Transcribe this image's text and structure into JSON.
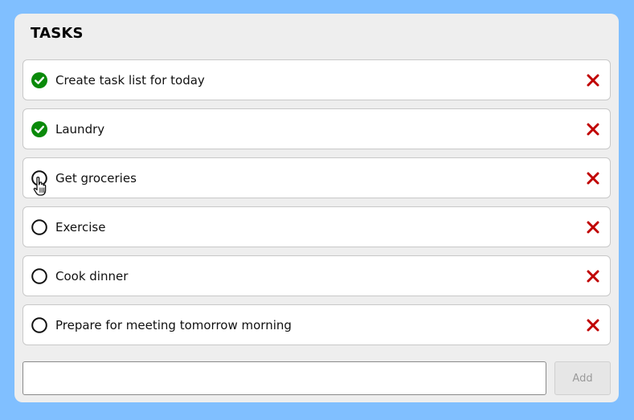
{
  "header": {
    "title": "TASKS"
  },
  "tasks": [
    {
      "label": "Create task list for today",
      "done": true
    },
    {
      "label": "Laundry",
      "done": true
    },
    {
      "label": "Get groceries",
      "done": false
    },
    {
      "label": "Exercise",
      "done": false
    },
    {
      "label": "Cook dinner",
      "done": false
    },
    {
      "label": "Prepare for meeting tomorrow morning",
      "done": false
    }
  ],
  "new_task": {
    "value": "",
    "placeholder": ""
  },
  "add_button": {
    "label": "Add"
  },
  "icons": {
    "done": "check-circle-icon",
    "pending": "empty-circle-icon",
    "delete": "close-icon",
    "cursor": "hand-pointer-icon"
  },
  "colors": {
    "background": "#80bfff",
    "panel": "#eeeeee",
    "done": "#0a8a0a",
    "delete": "#c00000"
  }
}
